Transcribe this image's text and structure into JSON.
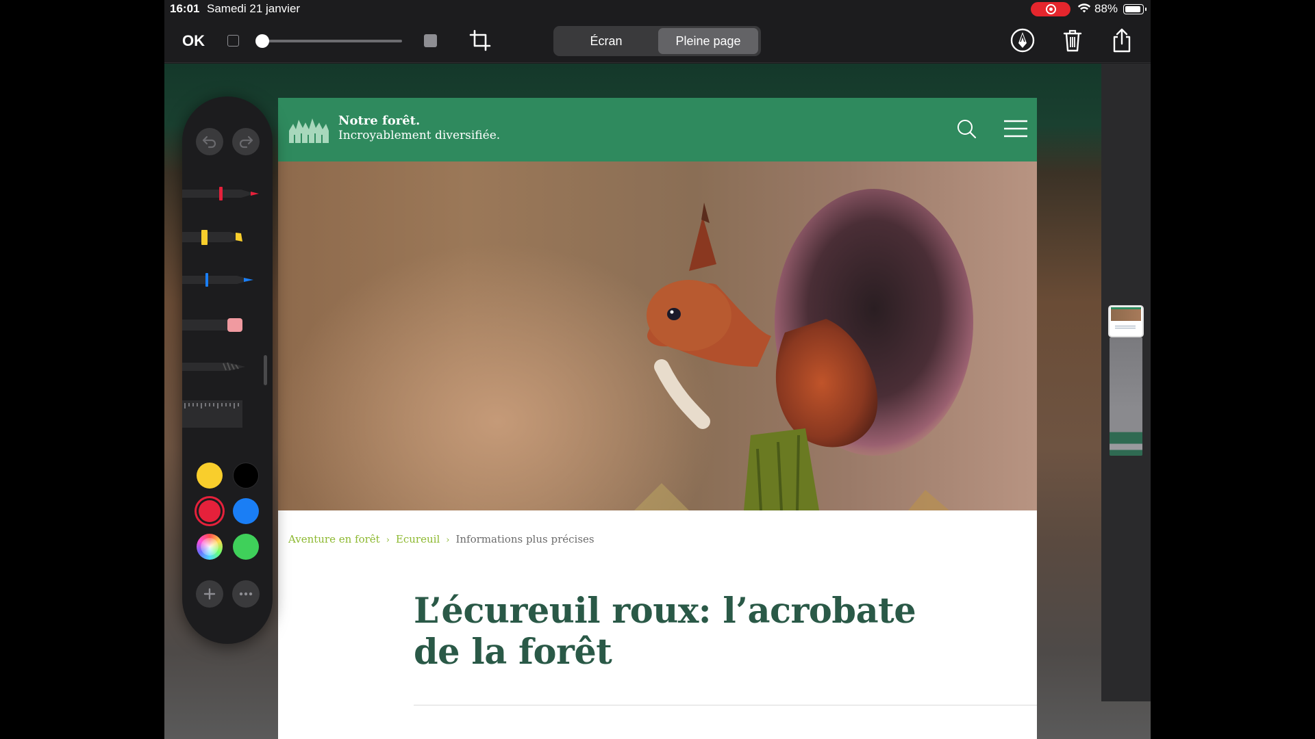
{
  "status_bar": {
    "time": "16:01",
    "date": "Samedi 21 janvier",
    "battery_percent": "88%",
    "screen_recording": true,
    "recording_color": "#e5262d"
  },
  "toolbar": {
    "ok_label": "OK",
    "opacity_slider_value": 0,
    "segments": [
      "Écran",
      "Pleine page"
    ],
    "selected_segment": "Pleine page",
    "icons": [
      "crop-icon",
      "markup-icon",
      "trash-icon",
      "share-icon"
    ]
  },
  "webpage": {
    "header": {
      "title": "Notre forêt.",
      "subtitle": "Incroyablement diversifiée.",
      "color": "#2f8a5e"
    },
    "hero_image": "red squirrel perched on a mossy stump",
    "breadcrumb": {
      "items": [
        "Aventure en forêt",
        "Ecureuil",
        "Informations plus précises"
      ],
      "separator": "›"
    },
    "article_title_line1": "L’écureuil roux: l’acrobate",
    "article_title_line2": "de la forêt",
    "title_color": "#2a5947"
  },
  "palette": {
    "tools": [
      "pen-tool",
      "highlighter-tool",
      "pencil-tool",
      "eraser-tool",
      "lasso-tool",
      "ruler-tool"
    ],
    "colors": {
      "yellow": "#f9ce2c",
      "black": "#000000",
      "red": "#e5213b",
      "blue": "#1a7ef5",
      "green": "#3fd05a"
    },
    "selected_color": "red"
  }
}
